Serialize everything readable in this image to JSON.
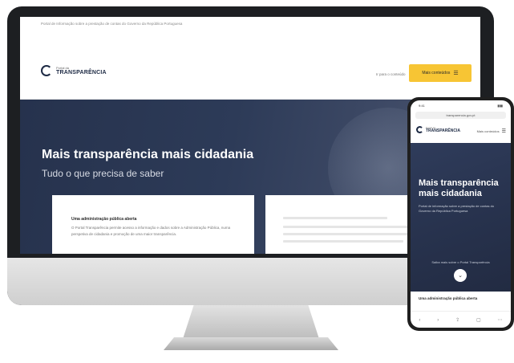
{
  "desktop": {
    "topbar_text": "Portal de Informação sobre a prestação de contas do Governo da República Portuguesa",
    "logo": {
      "small": "Portal da",
      "big": "TRANSPARÊNCIA"
    },
    "nav_link": "Ir para o conteúdo",
    "cta": {
      "label": "Mais conteúdos",
      "icon": "☰"
    },
    "hero": {
      "title": "Mais transparência mais cidadania",
      "subtitle": "Tudo o que precisa de saber"
    },
    "card1": {
      "title": "Uma administração pública aberta",
      "text": "O Portal Transparência permite acesso a informação e dados sobre a Administração Pública, numa perspetiva de cidadania e promoção de uma maior transparência."
    }
  },
  "phone": {
    "status_time": "9:41",
    "status_batt": "▮▮▮",
    "url": "transparencia.gov.pt",
    "logo": {
      "small": "Portal da",
      "big": "TRANSPARÊNCIA"
    },
    "menu_label": "Mais conteúdos",
    "menu_icon": "☰",
    "hero_title": "Mais transparência mais cidadania",
    "hero_text": "Portal de informação sobre a prestação de contas do Governo da República Portuguesa",
    "hero_caption": "Saiba mais sobre o Portal Transparência",
    "scroll_icon": "⌄",
    "card_title": "Uma administração pública aberta",
    "bottom_icons": [
      "‹",
      "›",
      "⇪",
      "▢",
      "⋯"
    ]
  }
}
